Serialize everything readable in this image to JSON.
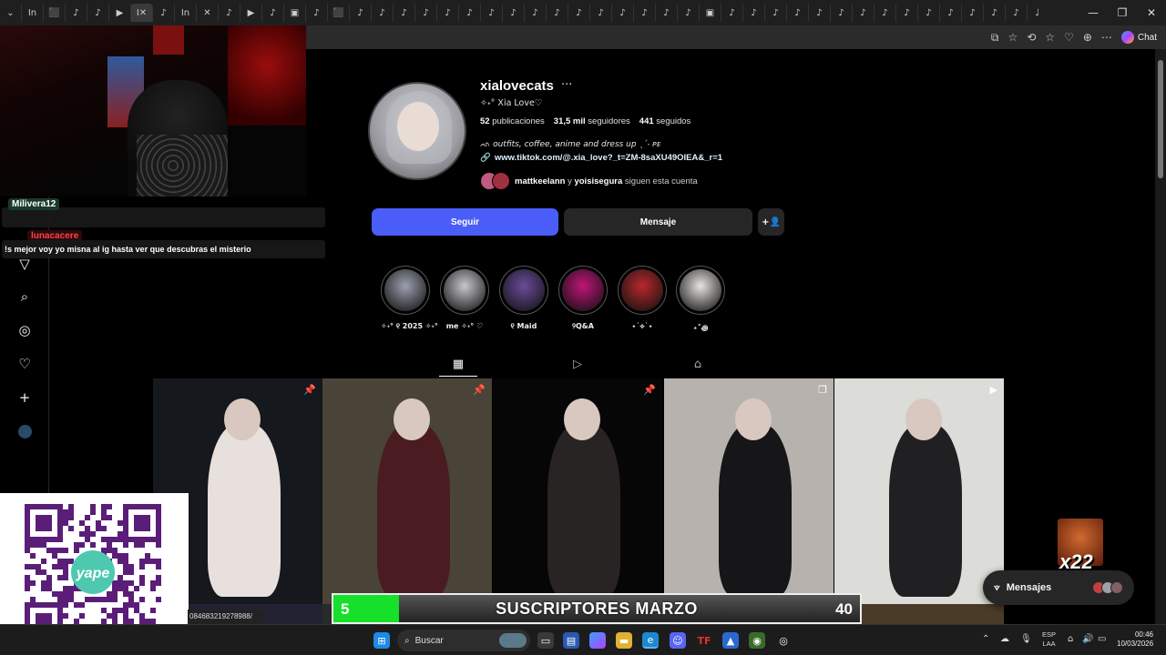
{
  "browser": {
    "tab_glyphs": [
      "⌄",
      "In",
      "⬛",
      "♪",
      "♪",
      "▶",
      "♪",
      "In",
      "✕",
      "♪",
      "▶",
      "♪",
      "▣",
      "♪",
      "⬛",
      "♪",
      "♪",
      "♪",
      "♪",
      "♪",
      "♪",
      "♪",
      "♪",
      "♪",
      "♪",
      "♪",
      "♪",
      "♪",
      "♪",
      "♪",
      "♪",
      "▣",
      "♪",
      "♪",
      "♪",
      "♪",
      "♪",
      "♪",
      "♪",
      "♪",
      "♪",
      "♪",
      "♪",
      "♪",
      "♪",
      "♪",
      "♪",
      "+"
    ],
    "active_tab_glyph": "I✕",
    "window_controls": [
      "—",
      "❐",
      "✕"
    ],
    "toolbar_icons": [
      "⧉",
      "☆",
      "⟲",
      "☆",
      "♡",
      "⊕",
      "⋯"
    ],
    "chat_label": "Chat"
  },
  "stream_chat": {
    "user1": "Milivera12",
    "user2": "lunacacere",
    "message": "!s mejor voy yo misna al ig hasta ver que descubras el misterio"
  },
  "profile": {
    "username": "xialovecats",
    "more": "···",
    "display_name": "✧˖° Xia Love♡",
    "stats": [
      {
        "value": "52",
        "label": "publicaciones"
      },
      {
        "value": "31,5 mil",
        "label": "seguidores"
      },
      {
        "value": "441",
        "label": "seguidos"
      }
    ],
    "bio": "ᨒ outfits, coffee, anime and dress up ˎˊ˗ ᴘᴇ",
    "link": "www.tiktok.com/@.xia_love?_t=ZM-8saXU49OIEA&_r=1",
    "followed_by_user1": "mattkeelann",
    "followed_by_joiner": "y",
    "followed_by_user2": "yoisisegura",
    "followed_by_suffix": "siguen esta cuenta",
    "follow_button": "Seguir",
    "message_button": "Mensaje",
    "suggest_icon": "+👤"
  },
  "highlights": [
    {
      "label": "✧˖° ୧ 2025 ✧˖°",
      "color": "#9ca0b0"
    },
    {
      "label": "me ✧˖°  ♡",
      "color": "#c8c8cc"
    },
    {
      "label": "୧ Maid",
      "color": "#6a4c9a"
    },
    {
      "label": "୨Q&A",
      "color": "#c01478"
    },
    {
      "label": "⋆˙⟡˙⋆",
      "color": "#b8282c"
    },
    {
      "label": "⋆˚꩜",
      "color": "#e8e4e0"
    }
  ],
  "posts": [
    {
      "pinned": true,
      "tag": "📌",
      "bg": "#15181c",
      "fig": "#e8e0dc"
    },
    {
      "pinned": true,
      "tag": "📌",
      "bg": "#4a4438",
      "fig": "#4a1c22"
    },
    {
      "pinned": true,
      "tag": "📌",
      "bg": "#060606",
      "fig": "#282424"
    },
    {
      "pinned": false,
      "tag": "❐",
      "bg": "#b8b2ae",
      "fig": "#161618"
    },
    {
      "pinned": false,
      "tag": "▶",
      "bg": "#dcdcd8",
      "fig": "#202022"
    }
  ],
  "qr_caption": "084683219278988/",
  "qr_brand": "yape",
  "subscribers": {
    "current": "5",
    "title": "SUSCRIPTORES MARZO",
    "goal": "40",
    "progress": 0.125
  },
  "messages_pill": {
    "label": "Mensajes",
    "icon": "⟇"
  },
  "badge_text": "x22",
  "taskbar": {
    "search_label": "Buscar",
    "lang_line1": "ESP",
    "lang_line2": "LAA",
    "time": "00:46",
    "date": "10/03/2026"
  }
}
